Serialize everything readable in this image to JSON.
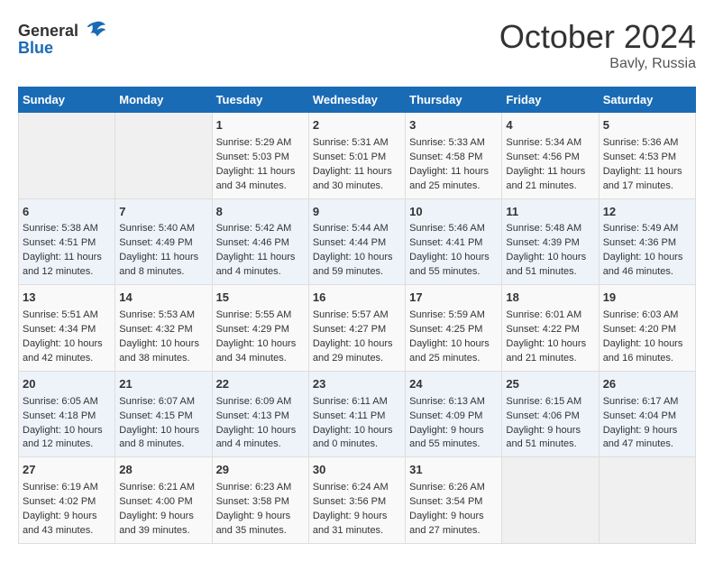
{
  "logo": {
    "general": "General",
    "blue": "Blue"
  },
  "title": "October 2024",
  "location": "Bavly, Russia",
  "days_of_week": [
    "Sunday",
    "Monday",
    "Tuesday",
    "Wednesday",
    "Thursday",
    "Friday",
    "Saturday"
  ],
  "weeks": [
    [
      {
        "day": "",
        "data": ""
      },
      {
        "day": "",
        "data": ""
      },
      {
        "day": "1",
        "data": "Sunrise: 5:29 AM\nSunset: 5:03 PM\nDaylight: 11 hours and 34 minutes."
      },
      {
        "day": "2",
        "data": "Sunrise: 5:31 AM\nSunset: 5:01 PM\nDaylight: 11 hours and 30 minutes."
      },
      {
        "day": "3",
        "data": "Sunrise: 5:33 AM\nSunset: 4:58 PM\nDaylight: 11 hours and 25 minutes."
      },
      {
        "day": "4",
        "data": "Sunrise: 5:34 AM\nSunset: 4:56 PM\nDaylight: 11 hours and 21 minutes."
      },
      {
        "day": "5",
        "data": "Sunrise: 5:36 AM\nSunset: 4:53 PM\nDaylight: 11 hours and 17 minutes."
      }
    ],
    [
      {
        "day": "6",
        "data": "Sunrise: 5:38 AM\nSunset: 4:51 PM\nDaylight: 11 hours and 12 minutes."
      },
      {
        "day": "7",
        "data": "Sunrise: 5:40 AM\nSunset: 4:49 PM\nDaylight: 11 hours and 8 minutes."
      },
      {
        "day": "8",
        "data": "Sunrise: 5:42 AM\nSunset: 4:46 PM\nDaylight: 11 hours and 4 minutes."
      },
      {
        "day": "9",
        "data": "Sunrise: 5:44 AM\nSunset: 4:44 PM\nDaylight: 10 hours and 59 minutes."
      },
      {
        "day": "10",
        "data": "Sunrise: 5:46 AM\nSunset: 4:41 PM\nDaylight: 10 hours and 55 minutes."
      },
      {
        "day": "11",
        "data": "Sunrise: 5:48 AM\nSunset: 4:39 PM\nDaylight: 10 hours and 51 minutes."
      },
      {
        "day": "12",
        "data": "Sunrise: 5:49 AM\nSunset: 4:36 PM\nDaylight: 10 hours and 46 minutes."
      }
    ],
    [
      {
        "day": "13",
        "data": "Sunrise: 5:51 AM\nSunset: 4:34 PM\nDaylight: 10 hours and 42 minutes."
      },
      {
        "day": "14",
        "data": "Sunrise: 5:53 AM\nSunset: 4:32 PM\nDaylight: 10 hours and 38 minutes."
      },
      {
        "day": "15",
        "data": "Sunrise: 5:55 AM\nSunset: 4:29 PM\nDaylight: 10 hours and 34 minutes."
      },
      {
        "day": "16",
        "data": "Sunrise: 5:57 AM\nSunset: 4:27 PM\nDaylight: 10 hours and 29 minutes."
      },
      {
        "day": "17",
        "data": "Sunrise: 5:59 AM\nSunset: 4:25 PM\nDaylight: 10 hours and 25 minutes."
      },
      {
        "day": "18",
        "data": "Sunrise: 6:01 AM\nSunset: 4:22 PM\nDaylight: 10 hours and 21 minutes."
      },
      {
        "day": "19",
        "data": "Sunrise: 6:03 AM\nSunset: 4:20 PM\nDaylight: 10 hours and 16 minutes."
      }
    ],
    [
      {
        "day": "20",
        "data": "Sunrise: 6:05 AM\nSunset: 4:18 PM\nDaylight: 10 hours and 12 minutes."
      },
      {
        "day": "21",
        "data": "Sunrise: 6:07 AM\nSunset: 4:15 PM\nDaylight: 10 hours and 8 minutes."
      },
      {
        "day": "22",
        "data": "Sunrise: 6:09 AM\nSunset: 4:13 PM\nDaylight: 10 hours and 4 minutes."
      },
      {
        "day": "23",
        "data": "Sunrise: 6:11 AM\nSunset: 4:11 PM\nDaylight: 10 hours and 0 minutes."
      },
      {
        "day": "24",
        "data": "Sunrise: 6:13 AM\nSunset: 4:09 PM\nDaylight: 9 hours and 55 minutes."
      },
      {
        "day": "25",
        "data": "Sunrise: 6:15 AM\nSunset: 4:06 PM\nDaylight: 9 hours and 51 minutes."
      },
      {
        "day": "26",
        "data": "Sunrise: 6:17 AM\nSunset: 4:04 PM\nDaylight: 9 hours and 47 minutes."
      }
    ],
    [
      {
        "day": "27",
        "data": "Sunrise: 6:19 AM\nSunset: 4:02 PM\nDaylight: 9 hours and 43 minutes."
      },
      {
        "day": "28",
        "data": "Sunrise: 6:21 AM\nSunset: 4:00 PM\nDaylight: 9 hours and 39 minutes."
      },
      {
        "day": "29",
        "data": "Sunrise: 6:23 AM\nSunset: 3:58 PM\nDaylight: 9 hours and 35 minutes."
      },
      {
        "day": "30",
        "data": "Sunrise: 6:24 AM\nSunset: 3:56 PM\nDaylight: 9 hours and 31 minutes."
      },
      {
        "day": "31",
        "data": "Sunrise: 6:26 AM\nSunset: 3:54 PM\nDaylight: 9 hours and 27 minutes."
      },
      {
        "day": "",
        "data": ""
      },
      {
        "day": "",
        "data": ""
      }
    ]
  ]
}
